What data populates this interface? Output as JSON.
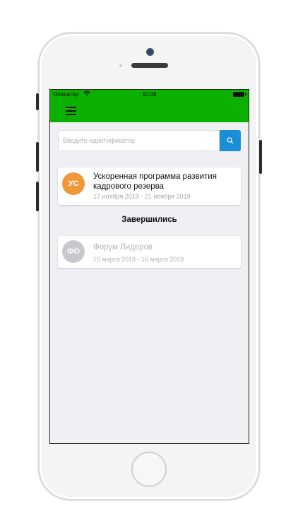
{
  "status_bar": {
    "carrier": "Оператор",
    "time": "10:09"
  },
  "search": {
    "placeholder": "Введите идентификатор"
  },
  "active_events": [
    {
      "initials": "УС",
      "title": "Ускоренная программа развития кадрового резерва",
      "dates": "17 ноября 2019 - 21 ноября 2019",
      "avatar_color": "#f0983a"
    }
  ],
  "finished_section": {
    "title": "Завершились",
    "events": [
      {
        "initials": "ФО",
        "title": "Форум Лидеров",
        "dates": "15 марта 2019 - 16 марта 2019",
        "avatar_color": "#c8c8cc"
      }
    ]
  },
  "colors": {
    "nav_green": "#0bb000",
    "search_blue": "#1b8fd6"
  },
  "icons": [
    "menu-icon",
    "search-icon",
    "wifi-icon",
    "battery-icon"
  ]
}
